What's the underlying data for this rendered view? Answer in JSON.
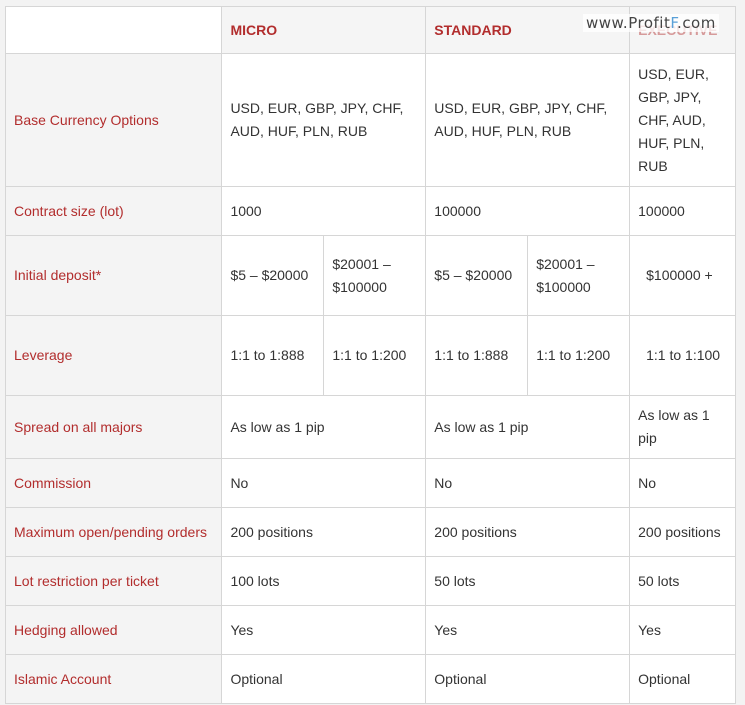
{
  "watermark": {
    "pre": "www.Profit",
    "f": "F",
    "post": ".com"
  },
  "headers": [
    "MICRO",
    "STANDARD",
    "EXECUTIVE"
  ],
  "rows": [
    {
      "label": "Base Currency Options",
      "micro": "USD, EUR, GBP, JPY, CHF, AUD, HUF, PLN, RUB",
      "standard": "USD, EUR, GBP, JPY, CHF, AUD, HUF, PLN, RUB",
      "executive": "USD, EUR, GBP, JPY, CHF, AUD, HUF, PLN, RUB"
    },
    {
      "label": "Contract size (lot)",
      "micro": "1000",
      "standard": "100000",
      "executive": "100000"
    },
    {
      "label": "Initial deposit*",
      "micro_a": "$5 – $20000",
      "micro_b": "$20001 – $100000",
      "standard_a": "$5 – $20000",
      "standard_b": "$20001 – $100000",
      "executive": "$100000 +"
    },
    {
      "label": "Leverage",
      "micro_a": "1:1 to 1:888",
      "micro_b": "1:1 to 1:200",
      "standard_a": "1:1 to 1:888",
      "standard_b": "1:1 to 1:200",
      "executive": "1:1 to 1:100"
    },
    {
      "label": "Spread on all majors",
      "micro": "As low as 1 pip",
      "standard": "As low as 1 pip",
      "executive": "As low as 1 pip"
    },
    {
      "label": "Commission",
      "micro": "No",
      "standard": "No",
      "executive": "No"
    },
    {
      "label": "Maximum open/pending orders",
      "micro": "200 positions",
      "standard": "200 positions",
      "executive": "200 positions"
    },
    {
      "label": "Lot restriction per ticket",
      "micro": "100 lots",
      "standard": "50 lots",
      "executive": "50 lots"
    },
    {
      "label": "Hedging allowed",
      "micro": "Yes",
      "standard": "Yes",
      "executive": "Yes"
    },
    {
      "label": "Islamic Account",
      "micro": "Optional",
      "standard": "Optional",
      "executive": "Optional"
    }
  ]
}
